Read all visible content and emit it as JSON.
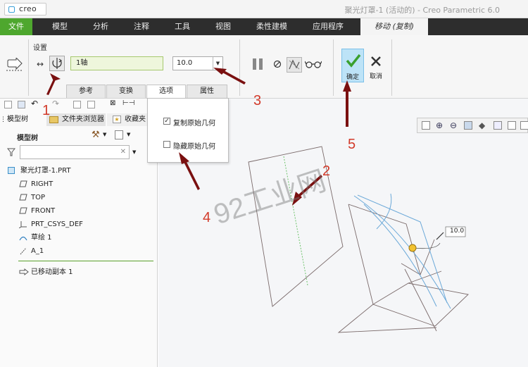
{
  "window": {
    "logo": "creo",
    "title": "聚光灯罩-1 (活动的) - Creo Parametric 6.0"
  },
  "menu": {
    "items": [
      "文件",
      "模型",
      "分析",
      "注释",
      "工具",
      "视图",
      "柔性建模",
      "应用程序"
    ],
    "active_tab": "移动 (复制)"
  },
  "ribbon": {
    "settings_label": "设置",
    "axis_ref": "1轴",
    "value": "10.0",
    "ok_label": "确定",
    "cancel_label": "取消",
    "subtabs": [
      "参考",
      "变换",
      "选项",
      "属性"
    ]
  },
  "options_panel": {
    "copy_original": {
      "label": "复制原始几何",
      "checked": true
    },
    "hide_original": {
      "label": "隐藏原始几何",
      "checked": false
    }
  },
  "left_panel": {
    "tabs": {
      "model_tree": "模型树",
      "folder_browser": "文件夹浏览器",
      "favorites": "收藏夹"
    },
    "tree_header": "模型树",
    "tree_items": [
      {
        "label": "聚光灯罩-1.PRT",
        "icon": "part-icon"
      },
      {
        "label": "RIGHT",
        "icon": "datum-plane-icon"
      },
      {
        "label": "TOP",
        "icon": "datum-plane-icon"
      },
      {
        "label": "FRONT",
        "icon": "datum-plane-icon"
      },
      {
        "label": "PRT_CSYS_DEF",
        "icon": "csys-icon"
      },
      {
        "label": "草绘 1",
        "icon": "sketch-icon"
      },
      {
        "label": "A_1",
        "icon": "axis-icon"
      },
      {
        "label": "已移动副本 1",
        "icon": "moved-copy-icon"
      }
    ]
  },
  "graphics": {
    "dimension_label": "10.0"
  },
  "annotations": {
    "step_labels": [
      "1",
      "2",
      "3",
      "4",
      "5"
    ],
    "watermark": "92工业网"
  },
  "colors": {
    "file_menu_green": "#4ea72e",
    "menubar_dark": "#2d2d2d",
    "ok_blue": "#bde3f7",
    "annotation_red": "#d23a2a",
    "arrow_dark_red": "#7a1010"
  }
}
